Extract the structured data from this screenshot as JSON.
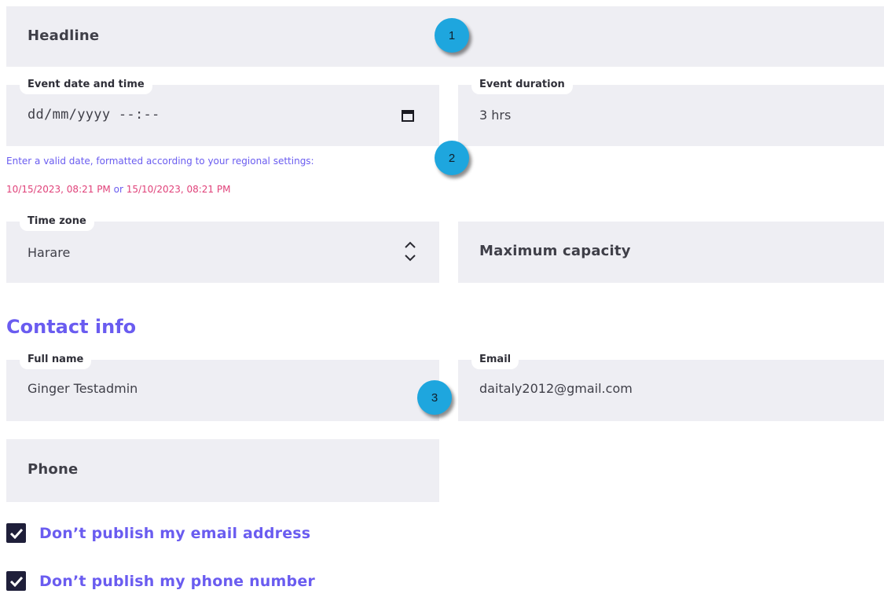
{
  "headline": {
    "placeholder": "Headline"
  },
  "event_date": {
    "label": "Event date and time",
    "value": "dd/mm/yyyy --:--",
    "icon": "calendar-icon",
    "help_text": "Enter a valid date, formatted according to your regional settings:",
    "example_1": "10/15/2023, 08:21 PM",
    "example_sep": " or ",
    "example_2": "15/10/2023, 08:21 PM"
  },
  "event_duration": {
    "label": "Event duration",
    "value": "3 hrs"
  },
  "time_zone": {
    "label": "Time zone",
    "value": "Harare",
    "icon": "up-down-chevron-icon"
  },
  "max_capacity": {
    "placeholder": "Maximum capacity"
  },
  "contact": {
    "title": "Contact info",
    "full_name": {
      "label": "Full name",
      "value": "Ginger Testadmin"
    },
    "email": {
      "label": "Email",
      "value": "daitaly2012@gmail.com"
    },
    "phone": {
      "placeholder": "Phone"
    }
  },
  "checkboxes": [
    {
      "label": "Don’t publish my email address",
      "checked": true
    },
    {
      "label": "Don’t publish my phone number",
      "checked": true
    }
  ],
  "badges": [
    "1",
    "2",
    "3"
  ],
  "colors": {
    "accent": "#6a5cf0",
    "pink": "#e0427a",
    "field_bg": "#eeeef3",
    "badge": "#1ea6de",
    "checkbox": "#1f1f3a"
  }
}
